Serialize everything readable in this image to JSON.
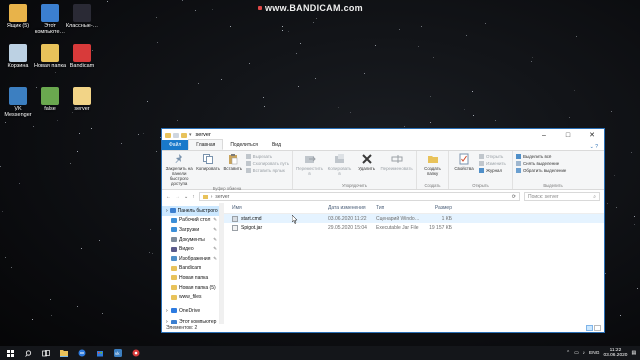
{
  "watermark": {
    "text": "www.BANDICAM.com"
  },
  "desktop": {
    "icons": [
      {
        "label": "Ящик (5)",
        "color": "#e8b34a"
      },
      {
        "label": "Этот компьюте…",
        "color": "#3b7fd0"
      },
      {
        "label": "Классные-…",
        "color": "#2a2a35"
      },
      {
        "label": "Корзина",
        "color": "#bcd1e3"
      },
      {
        "label": "Новая папка",
        "color": "#e8c25a"
      },
      {
        "label": "Bandicam",
        "color": "#d83a3a"
      },
      {
        "label": "VK Messenger",
        "color": "#3c7fc1"
      },
      {
        "label": "false",
        "color": "#6aa84f"
      },
      {
        "label": "server",
        "color": "#f2d487"
      }
    ]
  },
  "window": {
    "title": "server",
    "tabs": {
      "file": "Файл",
      "home": "Главная",
      "share": "Поделиться",
      "view": "Вид"
    },
    "ribbon": {
      "pin": "Закрепить на панели быстрого доступа",
      "copy": "Копировать",
      "paste": "Вставить",
      "cut": "Вырезать",
      "copy_path": "Скопировать путь",
      "paste_shortcut": "Вставить ярлык",
      "clipboard_group": "Буфер обмена",
      "move_to": "Переместить в",
      "copy_to": "Копировать в",
      "delete": "Удалить",
      "rename": "Переименовать",
      "organize_group": "Упорядочить",
      "new_folder": "Создать папку",
      "new_group": "Создать",
      "properties": "Свойства",
      "open": "Открыть",
      "edit": "Изменить",
      "journal": "Журнал",
      "open_group": "Открыть",
      "select_all": "Выделить всё",
      "select_none": "Снять выделение",
      "invert_selection": "Обратить выделение",
      "select_group": "Выделить"
    },
    "address": {
      "path": "server"
    },
    "search": {
      "placeholder": "Поиск: server"
    },
    "nav": {
      "items": [
        {
          "label": "Панель быстрого доступа",
          "color": "#3b7fd0",
          "pinned": false
        },
        {
          "label": "Рабочий стол",
          "color": "#3b8fd8",
          "pinned": true
        },
        {
          "label": "Загрузки",
          "color": "#3b8fd8",
          "pinned": true
        },
        {
          "label": "Документы",
          "color": "#7f8c9b",
          "pinned": true
        },
        {
          "label": "Видео",
          "color": "#5a5a8a",
          "pinned": true
        },
        {
          "label": "Изображения",
          "color": "#4f8fc9",
          "pinned": true
        },
        {
          "label": "Bandicam",
          "color": "#e8c25a",
          "pinned": false
        },
        {
          "label": "Новая папка",
          "color": "#e8c25a",
          "pinned": false
        },
        {
          "label": "Новая папка (5)",
          "color": "#e8c25a",
          "pinned": false
        },
        {
          "label": "www_files",
          "color": "#e8c25a",
          "pinned": false
        },
        {
          "label": "OneDrive",
          "color": "#2d7be0",
          "pinned": false
        },
        {
          "label": "Этот компьютер",
          "color": "#3b7fd0",
          "pinned": false
        }
      ]
    },
    "columns": {
      "name": "Имя",
      "date": "Дата изменения",
      "type": "Тип",
      "size": "Размер"
    },
    "files": [
      {
        "name": "start.cmd",
        "date": "03.06.2020 11:22",
        "type": "Сценарий Windo…",
        "size": "1 КБ"
      },
      {
        "name": "Spigot.jar",
        "date": "29.05.2020 15:04",
        "type": "Executable Jar File",
        "size": "19 157 КБ"
      }
    ],
    "status": "Элементов: 2"
  },
  "taskbar": {
    "lang": "ENG",
    "time": "11:22",
    "date": "03.06.2020"
  }
}
